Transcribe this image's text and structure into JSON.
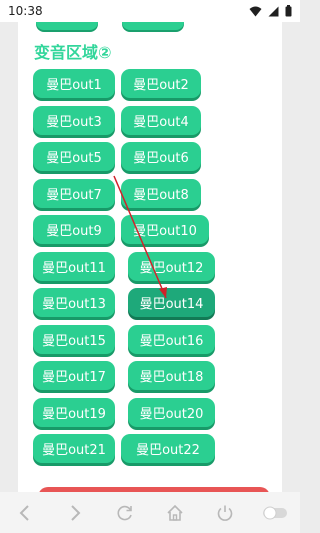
{
  "status": {
    "time": "10:38"
  },
  "section": {
    "title": "变音区域②"
  },
  "buttons": [
    "曼巴out1",
    "曼巴out2",
    "曼巴out3",
    "曼巴out4",
    "曼巴out5",
    "曼巴out6",
    "曼巴out7",
    "曼巴out8",
    "曼巴out9",
    "曼巴out10",
    "曼巴out11",
    "曼巴out12",
    "曼巴out13",
    "曼巴out14",
    "曼巴out15",
    "曼巴out16",
    "曼巴out17",
    "曼巴out18",
    "曼巴out19",
    "曼巴out20",
    "曼巴out21",
    "曼巴out22"
  ],
  "active_button": "曼巴out14",
  "nav": {
    "icons": [
      "back-icon",
      "forward-icon",
      "refresh-icon",
      "home-icon",
      "power-icon",
      "toggle-icon"
    ]
  },
  "colors": {
    "accent": "#2bcf91",
    "accent_dark": "#1ea97a",
    "title": "#32d69b",
    "red": "#e85555",
    "arrow": "#d0222a"
  }
}
